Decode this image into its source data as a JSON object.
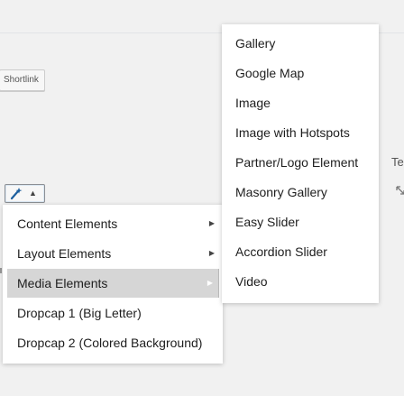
{
  "editor": {
    "shortlink_label": "Shortlink",
    "partial_right_text": "Te"
  },
  "shortcode_button": {
    "icon": "magic-wand-icon",
    "caret": "▲"
  },
  "main_menu": {
    "items": [
      {
        "label": "Content Elements",
        "has_submenu": true,
        "arrow": "▶"
      },
      {
        "label": "Layout Elements",
        "has_submenu": true,
        "arrow": "▶"
      },
      {
        "label": "Media Elements",
        "has_submenu": true,
        "arrow": "▶",
        "active": true
      },
      {
        "label": "Dropcap 1 (Big Letter)"
      },
      {
        "label": "Dropcap 2 (Colored Background)"
      }
    ]
  },
  "media_submenu": {
    "items": [
      {
        "label": "Gallery"
      },
      {
        "label": "Google Map"
      },
      {
        "label": "Image"
      },
      {
        "label": "Image with Hotspots"
      },
      {
        "label": "Partner/Logo Element"
      },
      {
        "label": "Masonry Gallery"
      },
      {
        "label": "Easy Slider"
      },
      {
        "label": "Accordion Slider"
      },
      {
        "label": "Video"
      }
    ]
  },
  "colors": {
    "menu_bg": "#ffffff",
    "active_bg": "#d6d6d6",
    "page_bg": "#f1f1f1",
    "text": "#1e1e1e"
  }
}
